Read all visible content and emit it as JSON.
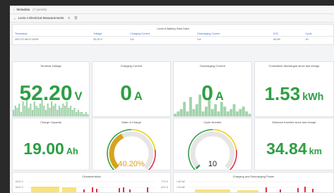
{
  "rows": {
    "metadata": {
      "title": "Metadata",
      "subtitle": "(7 panels)"
    },
    "level_a": {
      "title": "Levis A Electrical Measurements"
    }
  },
  "table_panel": {
    "title": "Level A Battery Raw Data",
    "columns": [
      "Timestamp",
      "Voltage",
      "Charging Current",
      "Discharging Current",
      "SOC",
      "Cycle"
    ],
    "rows": [
      [
        "2017-07-08 07:19:09",
        "52.20 V",
        "0 A",
        "0 A",
        "40.2%",
        "10"
      ]
    ]
  },
  "stats": {
    "voltage": {
      "title": "Terminal Voltage",
      "value": "52.20",
      "unit": "V",
      "sparkline": [
        0.3,
        0.5,
        0.4,
        0.6,
        0.2,
        0.7,
        0.5,
        0.8,
        0.4,
        0.6,
        0.3,
        0.7,
        0.5,
        0.4,
        0.6,
        0.8,
        0.5,
        0.3,
        0.6,
        0.4,
        0.7,
        0.5,
        0.6,
        0.3,
        0.5,
        0.4,
        0.6,
        0.5,
        0.7,
        0.4,
        0.5,
        0.3,
        0.4,
        0.2,
        0.3,
        0.2,
        0.2,
        0.1,
        0.2,
        0.1
      ]
    },
    "charging": {
      "title": "Charging Current",
      "value": "0",
      "unit": "A"
    },
    "discharging": {
      "title": "Discharging Current",
      "value": "0",
      "unit": "A",
      "sparkline": [
        0.1,
        0.2,
        0.3,
        0.6,
        0.2,
        0.8,
        0.3,
        0.5,
        0.9,
        0.2,
        0.4,
        0.7,
        0.3,
        0.5,
        0.2,
        0.6,
        0.4,
        0.2,
        0.3,
        0.5,
        0.2,
        0.3,
        0.4,
        0.2,
        0.1
      ]
    },
    "energy": {
      "title": "Cumulative discharged since last charge",
      "value": "1.53",
      "unit": "kWh"
    },
    "capacity": {
      "title": "Charge Capacity",
      "value": "19.00",
      "unit": "Ah"
    },
    "distance": {
      "title": "Distance traveled since last charge",
      "value": "34.84",
      "unit": "km"
    }
  },
  "gauges": {
    "soc": {
      "title": "State of Charge",
      "value_text": "40.20%",
      "fraction": 0.402,
      "color": "#d8a31c",
      "text_color": "#d8a31c"
    },
    "cycles": {
      "title": "Cycle Number",
      "value_text": "10",
      "fraction": 0.02,
      "color": "#2f9e44",
      "text_color": "#222222"
    }
  },
  "charts": {
    "characteristics": {
      "title": "Characteristics",
      "left_ticks": [
        "60.00 V",
        "50.00 V"
      ],
      "right_ticks": [
        "77.5 %",
        "62.5 %"
      ]
    },
    "charge_discharge": {
      "title": "Charging and Discharging Power",
      "left_ticks": [
        "1.50 kW",
        "1.00 kW"
      ],
      "right_ticks": [
        "",
        ""
      ]
    }
  },
  "colors": {
    "green": "#2f9e44",
    "yellow": "#f2cc0c",
    "red": "#e02f44",
    "blue": "#3274d9"
  }
}
